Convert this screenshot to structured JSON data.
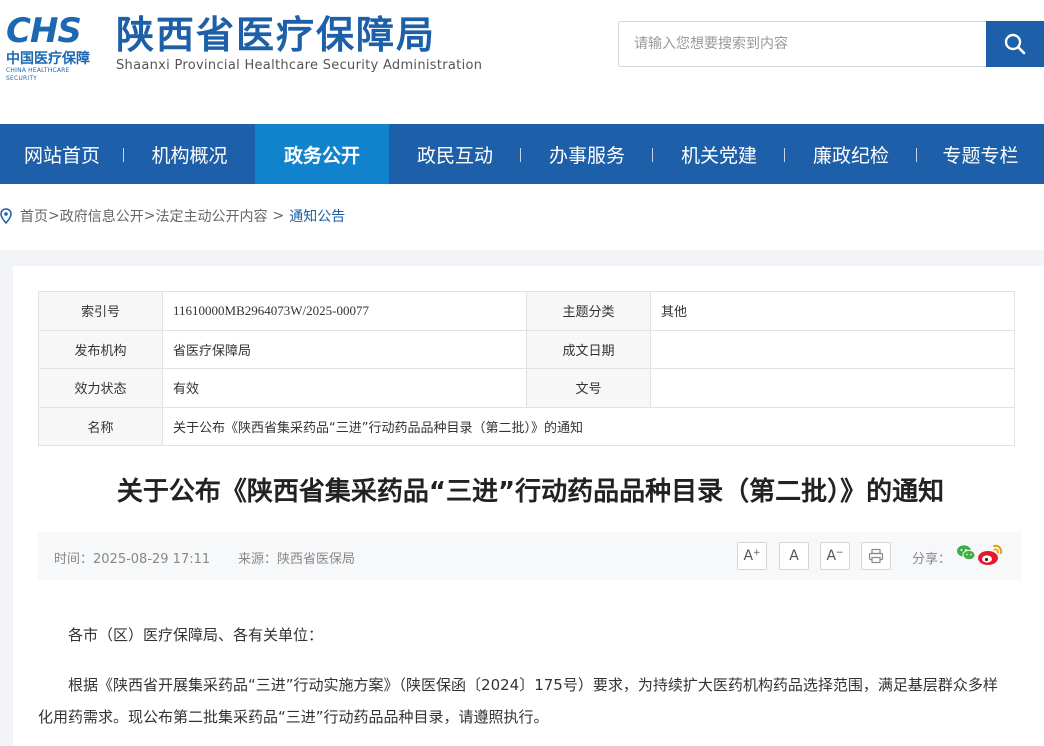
{
  "header": {
    "logo_text": "CHS",
    "logo_cn": "中国医疗保障",
    "logo_en": "CHINA HEALTHCARE SECURITY",
    "title": "陕西省医疗保障局",
    "subtitle": "Shaanxi Provincial Healthcare Security Administration",
    "search_placeholder": "请输入您想要搜索到内容"
  },
  "nav": {
    "items": [
      {
        "label": "网站首页",
        "active": false
      },
      {
        "label": "机构概况",
        "active": false
      },
      {
        "label": "政务公开",
        "active": true
      },
      {
        "label": "政民互动",
        "active": false
      },
      {
        "label": "办事服务",
        "active": false
      },
      {
        "label": "机关党建",
        "active": false
      },
      {
        "label": "廉政纪检",
        "active": false
      },
      {
        "label": "专题专栏",
        "active": false
      }
    ]
  },
  "breadcrumb": {
    "items": [
      "首页",
      "政府信息公开",
      "法定主动公开内容"
    ],
    "separator": ">",
    "current": "通知公告"
  },
  "info": {
    "index_label": "索引号",
    "index_value": "11610000MB2964073W/2025-00077",
    "topic_label": "主题分类",
    "topic_value": "其他",
    "publisher_label": "发布机构",
    "publisher_value": "省医疗保障局",
    "date_label": "成文日期",
    "date_value": "",
    "status_label": "效力状态",
    "status_value": "有效",
    "docno_label": "文号",
    "docno_value": "",
    "name_label": "名称",
    "name_value": "关于公布《陕西省集采药品“三进”行动药品品种目录（第二批）》的通知"
  },
  "article": {
    "title": "关于公布《陕西省集采药品“三进”行动药品品种目录（第二批）》的通知",
    "time": "时间：2025-08-29 17:11",
    "source": "来源：陕西省医保局",
    "font_a": "A",
    "font_larger_mark": "+",
    "font_smaller_mark": "−",
    "share_label": "分享：",
    "p1": "各市（区）医疗保障局、各有关单位：",
    "p2": "根据《陕西省开展集采药品“三进”行动实施方案》（陕医保函〔2024〕175号）要求，为持续扩大医药机构药品选择范围，满足基层群众多样化用药需求。现公布第二批集采药品“三进”行动药品品种目录，请遵照执行。"
  },
  "colors": {
    "brand_blue": "#1d5fa8",
    "nav_active": "#1183cd",
    "wechat_green": "#3fae45",
    "weibo_red": "#e6162d"
  }
}
